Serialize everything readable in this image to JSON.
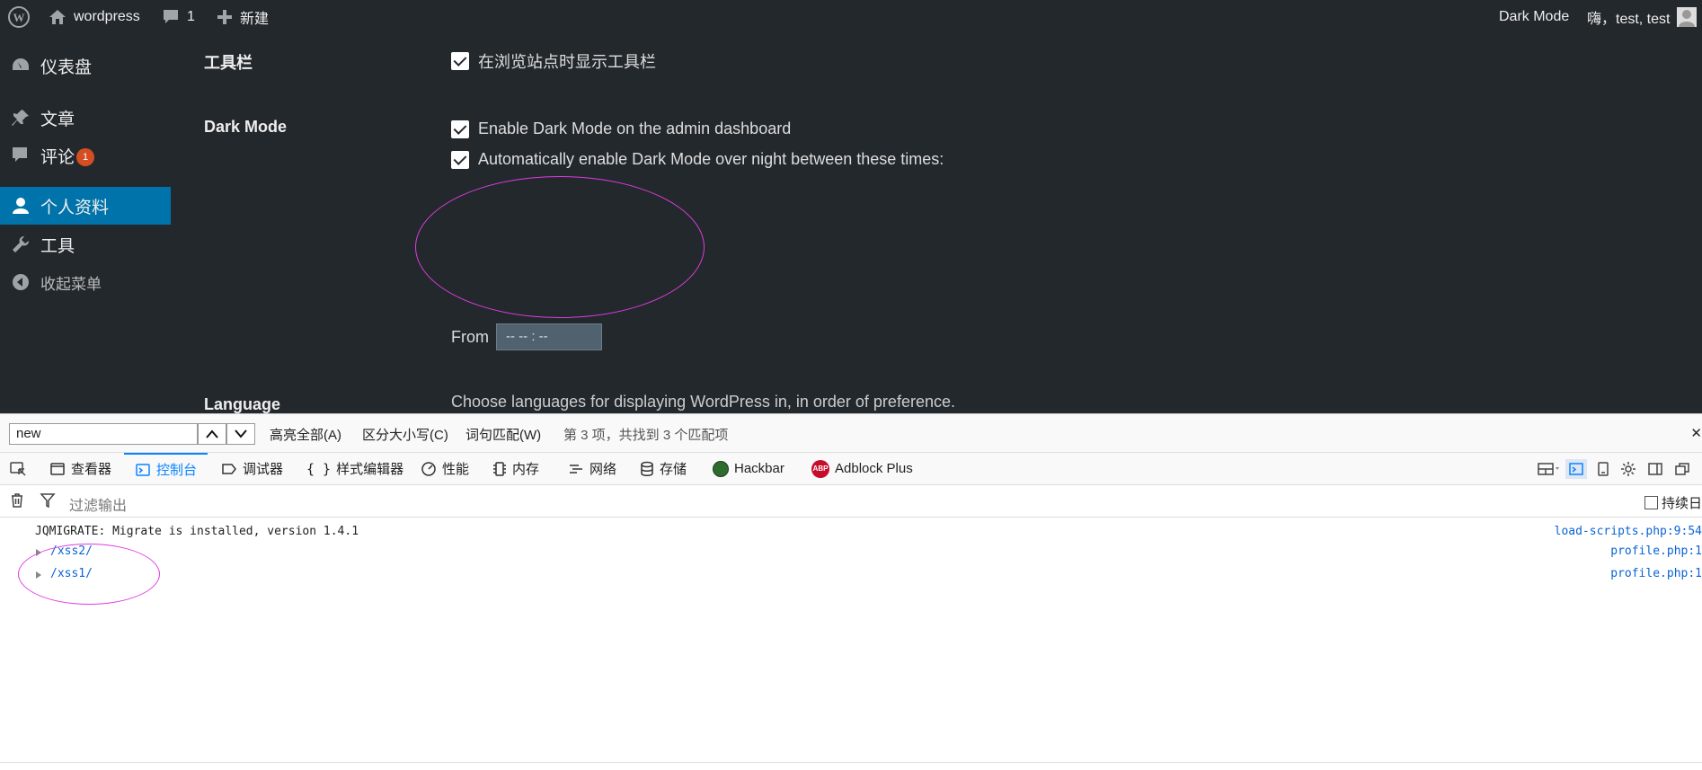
{
  "adminbar": {
    "site_name": "wordpress",
    "comments_count": "1",
    "new_label": "新建",
    "dark_mode_label": "Dark Mode",
    "greeting": "嗨，test, test"
  },
  "sidebar": {
    "items": [
      {
        "label": "仪表盘",
        "icon": "dashboard-icon"
      },
      {
        "label": "文章",
        "icon": "pin-icon"
      },
      {
        "label": "评论",
        "icon": "comment-icon",
        "badge": "1"
      },
      {
        "label": "个人资料",
        "icon": "user-icon",
        "active": true
      },
      {
        "label": "工具",
        "icon": "wrench-icon"
      },
      {
        "label": "收起菜单",
        "icon": "collapse-icon"
      }
    ]
  },
  "settings": {
    "toolbar_heading": "工具栏",
    "toolbar_checkbox": "在浏览站点时显示工具栏",
    "darkmode_heading": "Dark Mode",
    "darkmode_checkbox1": "Enable Dark Mode on the admin dashboard",
    "darkmode_checkbox2": "Automatically enable Dark Mode over night between these times:",
    "from_label": "From",
    "from_value": "-- -- : --",
    "language_heading": "Language",
    "language_desc": "Choose languages for displaying WordPress in, in order of preference."
  },
  "findbar": {
    "query": "new",
    "highlight_all": "高亮全部(A)",
    "match_case": "区分大小写(C)",
    "whole_words": "词句匹配(W)",
    "status": "第 3 项，共找到 3 个匹配项"
  },
  "devtools": {
    "tabs": [
      {
        "label": "查看器",
        "icon": "inspector-icon"
      },
      {
        "label": "控制台",
        "icon": "console-icon",
        "selected": true
      },
      {
        "label": "调试器",
        "icon": "debugger-icon"
      },
      {
        "label": "样式编辑器",
        "icon": "braces-icon"
      },
      {
        "label": "性能",
        "icon": "performance-icon"
      },
      {
        "label": "内存",
        "icon": "memory-icon"
      },
      {
        "label": "网络",
        "icon": "network-icon"
      },
      {
        "label": "存储",
        "icon": "storage-icon"
      },
      {
        "label": "Hackbar",
        "icon": "hackbar-icon"
      },
      {
        "label": "Adblock Plus",
        "icon": "abp-icon",
        "icon_text": "ABP"
      }
    ],
    "filter_placeholder": "过滤输出",
    "persist_label": "持续日"
  },
  "console": {
    "rows": [
      {
        "message": "JQMIGRATE: Migrate is installed, version 1.4.1",
        "source": "load-scripts.php:9:54"
      },
      {
        "message": "/xss2/",
        "source": "profile.php:1"
      },
      {
        "message": "/xss1/",
        "source": "profile.php:1"
      }
    ]
  },
  "colors": {
    "wp_background": "#23282d",
    "wp_active": "#0073aa",
    "badge": "#d54e21",
    "devtools_accent": "#0a84ff",
    "annotation": "#e03ce0"
  }
}
